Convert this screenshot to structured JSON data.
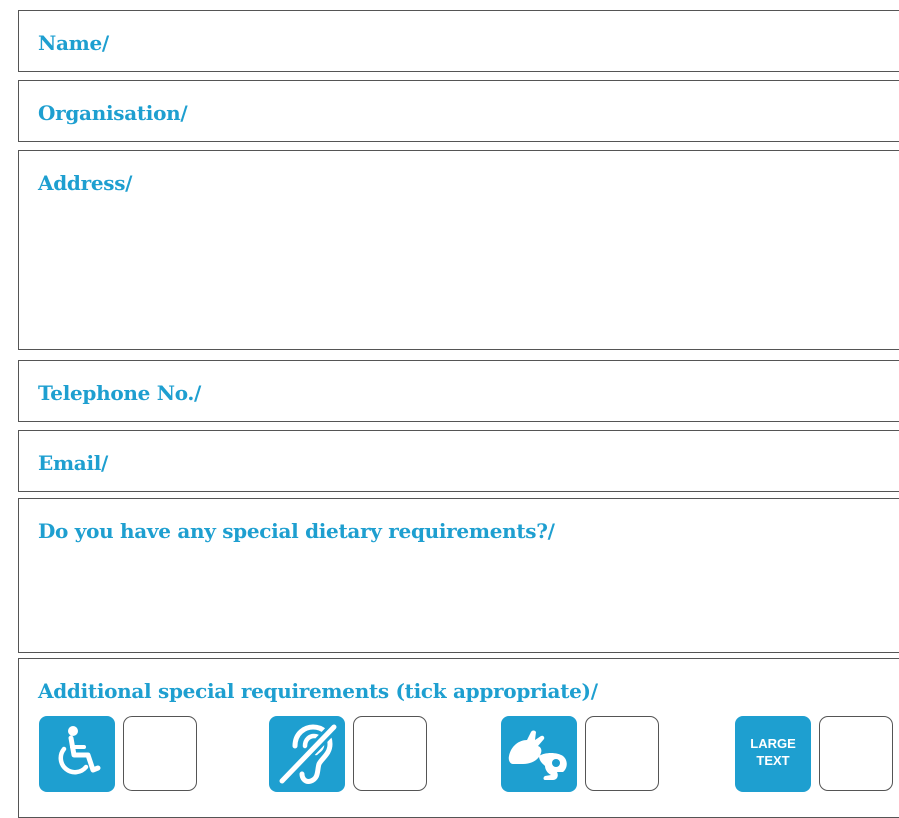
{
  "form": {
    "fields": [
      {
        "label": "Name/"
      },
      {
        "label": "Organisation/"
      },
      {
        "label": "Address/"
      },
      {
        "label": "Telephone No./"
      },
      {
        "label": "Email/"
      },
      {
        "label": "Do you have any special dietary requirements?/"
      }
    ],
    "requirements": {
      "label": "Additional special requirements (tick appropriate)/",
      "options": [
        {
          "icon": "wheelchair-access-icon",
          "checked": false
        },
        {
          "icon": "hearing-loop-icon",
          "checked": false
        },
        {
          "icon": "sign-language-icon",
          "checked": false
        },
        {
          "icon": "large-text-icon",
          "text_line1": "LARGE",
          "text_line2": "TEXT",
          "checked": false
        }
      ]
    }
  },
  "colors": {
    "accent": "#1e9fd0",
    "border": "#555555",
    "background": "#ffffff"
  }
}
